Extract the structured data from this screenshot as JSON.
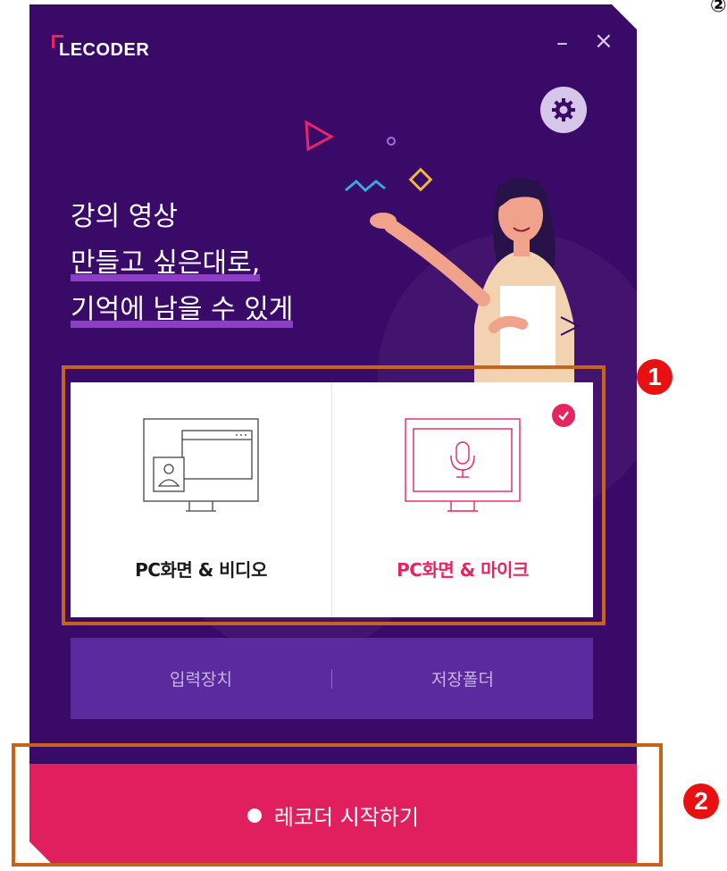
{
  "app": {
    "logo": "LECODER",
    "minimize_label": "–",
    "close_label": "×"
  },
  "headline": {
    "line1": "강의 영상",
    "line2": "만들고 싶은대로,",
    "line3": "기억에 남을 수 있게"
  },
  "modes": [
    {
      "label": "PC화면 & 비디오",
      "icon": "monitor-window-person-icon",
      "selected": false
    },
    {
      "label": "PC화면 & 마이크",
      "icon": "monitor-microphone-icon",
      "selected": true
    }
  ],
  "bottom_bar": {
    "input_device": "입력장치",
    "save_folder": "저장폴더"
  },
  "start_button": {
    "label": "레코더 시작하기"
  },
  "annotations": {
    "badge1": "1",
    "badge2": "2",
    "corner": "②"
  },
  "colors": {
    "background": "#3a0a68",
    "accent": "#e11f5e",
    "bar": "#5a2a9e",
    "annotation": "#c8641a"
  }
}
